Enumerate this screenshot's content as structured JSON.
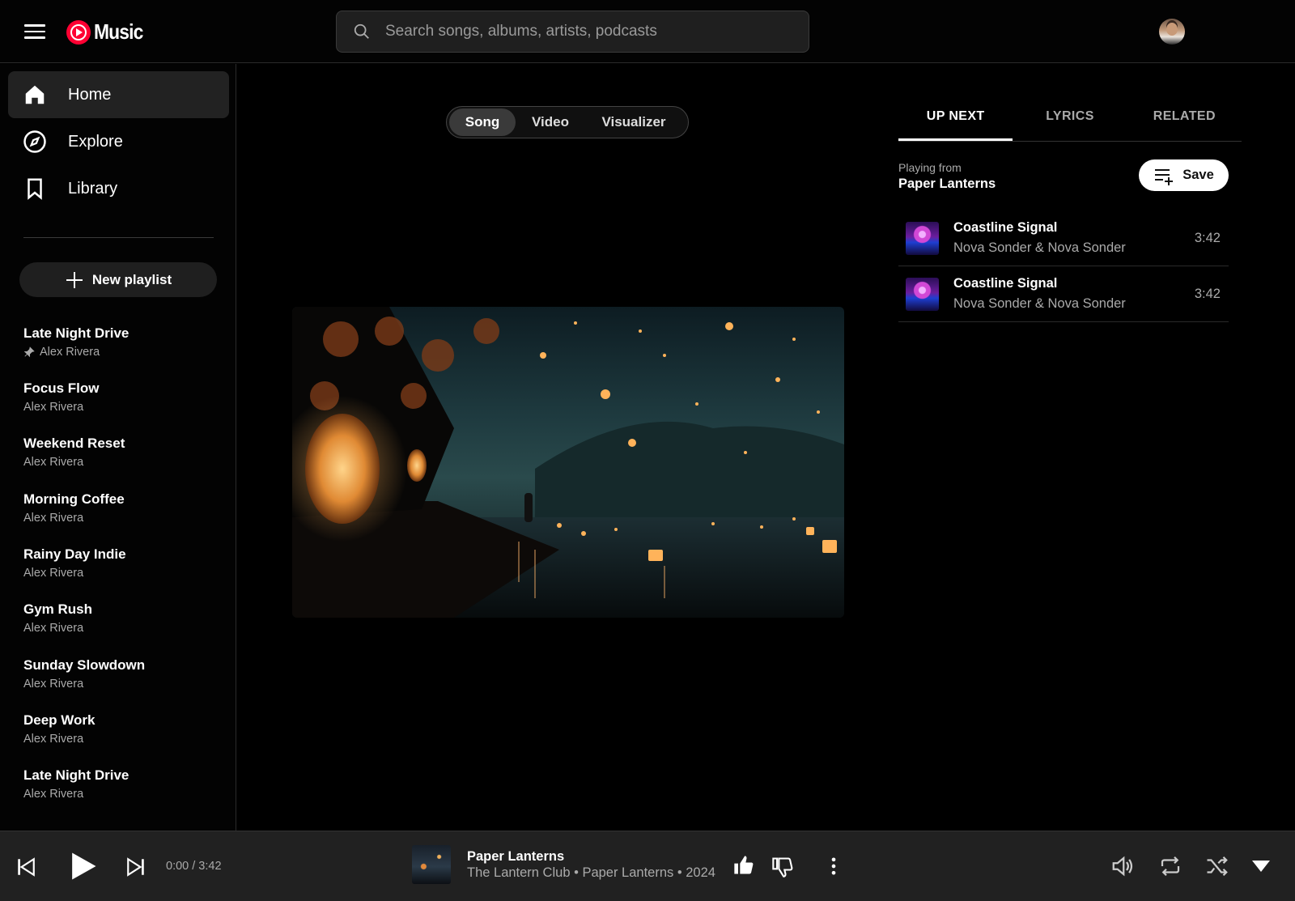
{
  "app": {
    "name": "Music",
    "brand_color": "#ff0033"
  },
  "search": {
    "placeholder": "Search songs, albums, artists, podcasts"
  },
  "sidebar": {
    "nav": [
      {
        "label": "Home",
        "icon": "home-icon",
        "active": true
      },
      {
        "label": "Explore",
        "icon": "compass-icon",
        "active": false
      },
      {
        "label": "Library",
        "icon": "bookmark-icon",
        "active": false
      }
    ],
    "new_playlist_label": "New playlist",
    "playlists": [
      {
        "title": "Late Night Drive",
        "owner": "Alex Rivera",
        "pinned": true
      },
      {
        "title": "Focus Flow",
        "owner": "Alex Rivera"
      },
      {
        "title": "Weekend Reset",
        "owner": "Alex Rivera"
      },
      {
        "title": "Morning Coffee",
        "owner": "Alex Rivera"
      },
      {
        "title": "Rainy Day Indie",
        "owner": "Alex Rivera"
      },
      {
        "title": "Gym Rush",
        "owner": "Alex Rivera"
      },
      {
        "title": "Sunday Slowdown",
        "owner": "Alex Rivera"
      },
      {
        "title": "Deep Work",
        "owner": "Alex Rivera"
      },
      {
        "title": "Late Night Drive",
        "owner": "Alex Rivera"
      }
    ]
  },
  "main": {
    "mode_toggle": [
      {
        "label": "Song",
        "active": true
      },
      {
        "label": "Video",
        "active": false
      },
      {
        "label": "Visualizer",
        "active": false
      }
    ]
  },
  "queue_panel": {
    "tabs": [
      {
        "label": "UP NEXT",
        "active": true
      },
      {
        "label": "LYRICS",
        "active": false
      },
      {
        "label": "RELATED",
        "active": false
      }
    ],
    "playing_from_label": "Playing from",
    "playing_from_value": "Paper Lanterns",
    "save_label": "Save",
    "items": [
      {
        "title": "Coastline Signal",
        "artist": "Nova Sonder & Nova Sonder",
        "duration": "3:42"
      },
      {
        "title": "Coastline Signal",
        "artist": "Nova Sonder & Nova Sonder",
        "duration": "3:42"
      }
    ]
  },
  "player": {
    "time": "0:00 / 3:42",
    "title": "Paper Lanterns",
    "subtitle": "The Lantern Club • Paper Lanterns • 2024",
    "progress_fraction": 0
  }
}
